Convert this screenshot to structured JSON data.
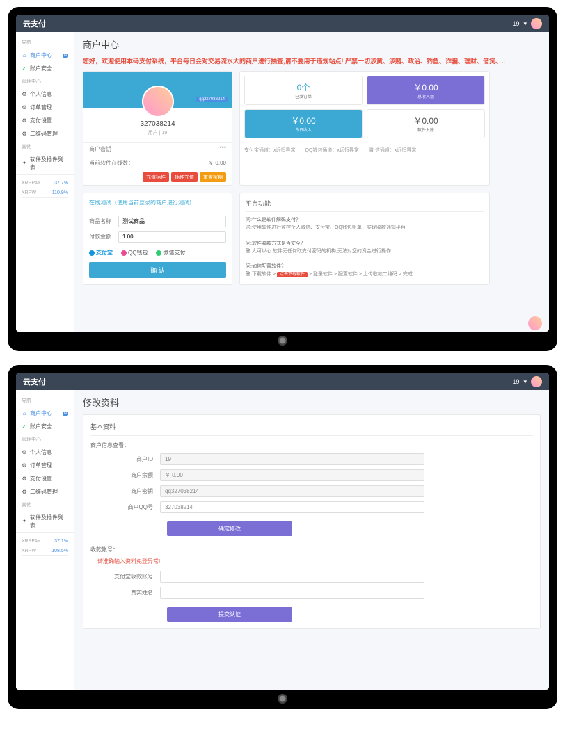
{
  "app_name": "云支付",
  "topbar_user": "19",
  "marquee": "您好，欢迎使用本码支付系统，平台每日会对交易流水大的商户进行抽查,请不要用于违规站点! 严禁一切涉黄、涉赌、政治、钓鱼、诈骗、理财、借贷、..",
  "sidebar": {
    "s1": "导航",
    "item_home": "商户中心",
    "badge_home": "N",
    "item_security": "账户安全",
    "s2": "管理中心",
    "item_profile": "个人信息",
    "item_orders": "订单管理",
    "item_paycfg": "支付设置",
    "item_qrcode": "二维码管理",
    "s3": "其他",
    "item_plugins": "软件及插件列表",
    "stats1": {
      "XRPPAY": {
        "label": "XRPPAY",
        "val": "37.7%"
      },
      "XRPW": {
        "label": "XRPW",
        "val": "110.9%"
      }
    }
  },
  "sidebar2": {
    "XRPPAY": "37.1%",
    "XRPW": "108.5%"
  },
  "screen1": {
    "title": "商户中心",
    "profile": {
      "id": "327038214",
      "sub": "用户 | 19",
      "qq_tag": "qq327038214",
      "key_label": "商户密钥",
      "balance_label": "当前软件在线数：",
      "balance_val": "￥ 0.00"
    },
    "btns": {
      "a": "充值插件",
      "b": "插件充值",
      "c": "重置密钥"
    },
    "stats": {
      "s1_val": "0个",
      "s1_lab": "已发订单",
      "s2_val": "￥0.00",
      "s2_lab": "总收入额",
      "s3_val": "￥0.00",
      "s3_lab": "今日收入",
      "s4_val": "￥0.00",
      "s4_lab": "软件入账"
    },
    "stats_foot": "支付宝通道：x远恒异常　　QQ钱包通道：x远恒异常　　微 信通道：x远恒异常",
    "test": {
      "title": "在线测试（使用当前登录的商户进行测试）",
      "name_label": "商品名称",
      "name_ph": "测试商品",
      "amt_label": "付款金额",
      "amt_ph": "1.00",
      "opt1": "支付宝",
      "opt2": "QQ钱包",
      "opt3": "微信支付",
      "btn": "确 认"
    },
    "notice": {
      "title": "平台功能",
      "q1": "问:什么是软件解码支付？",
      "a1": "答:使用软件进行监控个人微信、支付宝、QQ钱包账单，实现收款通知平台",
      "q2": "问:软件收款方式是否安全？",
      "a2": "答:大可以心.软件无任何取支付密码的机构,无法对您的资金进行操作",
      "q3": "问:如何配置软件？",
      "a3": "答:下载软件 > ",
      "a3_btn": "点击下载软件",
      "a3_end": " > 登录软件 > 配置软件 > 上传收款二维码 > 完成"
    }
  },
  "screen2": {
    "title": "修改资料",
    "panel_title": "基本资料",
    "sub1": "商户信息查看：",
    "rows": {
      "r1_l": "商户ID",
      "r1_v": "19",
      "r2_l": "商户余额",
      "r2_v": "￥ 0.00",
      "r3_l": "商户密钥",
      "r3_v": "qq327038214",
      "r4_l": "商户QQ号",
      "r4_v": "327038214"
    },
    "btn1": "确定修改",
    "sub2": "收款帐号：",
    "warn": "请准确输入资料免登异常!",
    "rows2": {
      "r5_l": "支付宝收款账号",
      "r6_l": "真实姓名"
    },
    "btn2": "提交认证"
  }
}
